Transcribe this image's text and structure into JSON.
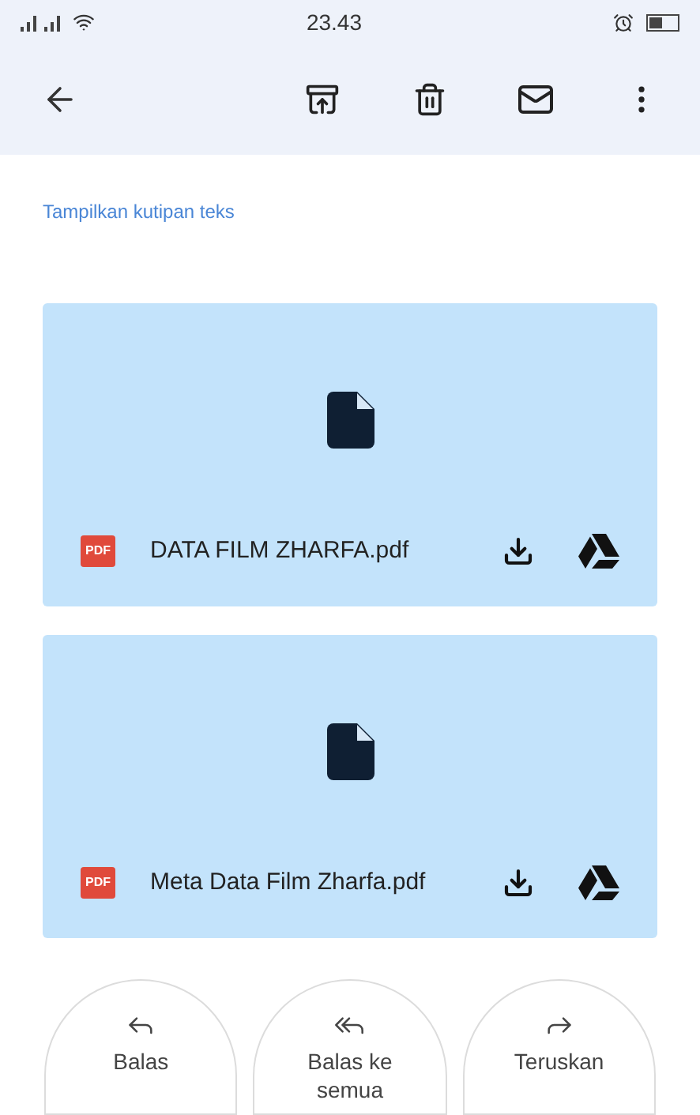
{
  "status_bar": {
    "time": "23.43"
  },
  "quote_link": "Tampilkan kutipan teks",
  "attachments": [
    {
      "name": "DATA FILM ZHARFA.pdf",
      "badge": "PDF"
    },
    {
      "name": "Meta Data Film Zharfa.pdf",
      "badge": "PDF"
    }
  ],
  "actions": [
    {
      "kind": "reply",
      "label": "Balas"
    },
    {
      "kind": "reply_all",
      "label": "Balas ke semua"
    },
    {
      "kind": "forward",
      "label": "Teruskan"
    }
  ]
}
